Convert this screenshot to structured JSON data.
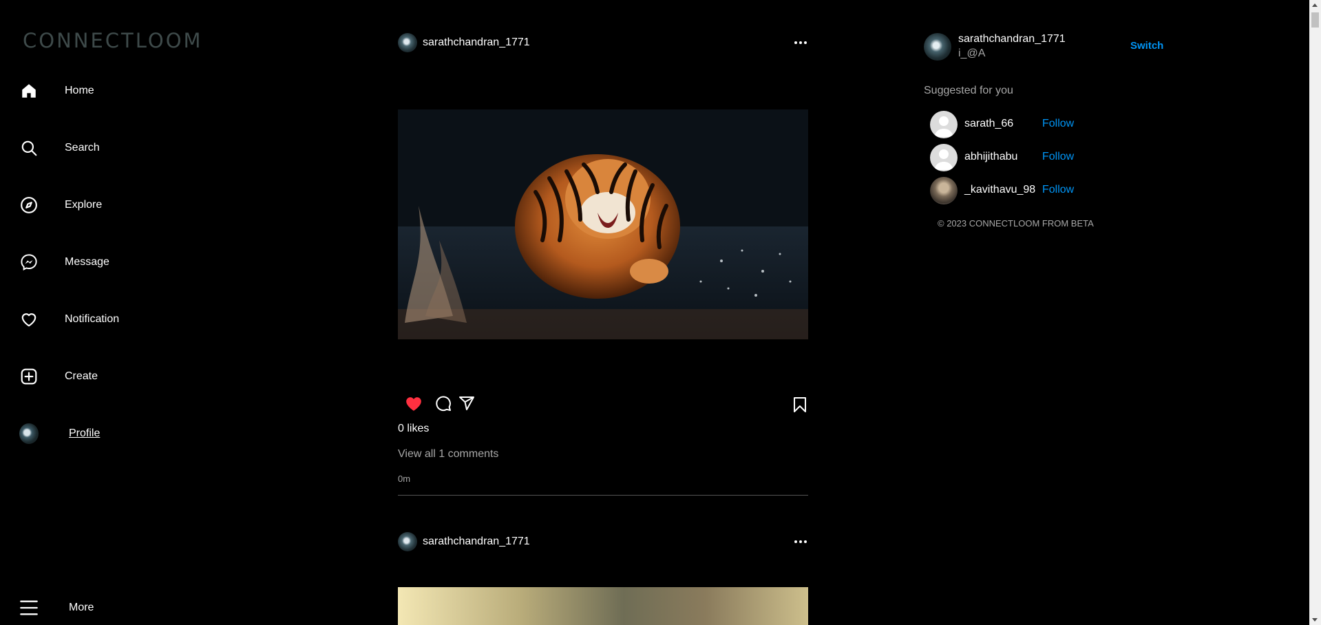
{
  "app": {
    "logo": "CONNECTLOOM"
  },
  "sidebar": {
    "items": [
      {
        "label": "Home",
        "icon": "home-icon"
      },
      {
        "label": "Search",
        "icon": "search-icon"
      },
      {
        "label": "Explore",
        "icon": "compass-icon"
      },
      {
        "label": "Message",
        "icon": "messenger-icon"
      },
      {
        "label": "Notification",
        "icon": "heart-icon"
      },
      {
        "label": "Create",
        "icon": "plus-square-icon"
      },
      {
        "label": "Profile",
        "icon": "avatar"
      }
    ],
    "more_label": "More"
  },
  "feed": {
    "posts": [
      {
        "username": "sarathchandran_1771",
        "likes": "0 likes",
        "comments_link": "View all 1 comments",
        "time": "0m",
        "liked": true
      },
      {
        "username": "sarathchandran_1771"
      }
    ]
  },
  "right": {
    "me": {
      "username": "sarathchandran_1771",
      "subtitle": "i_@A",
      "switch_label": "Switch"
    },
    "suggested_title": "Suggested for you",
    "suggestions": [
      {
        "username": "sarath_66",
        "action": "Follow"
      },
      {
        "username": "abhijithabu",
        "action": "Follow"
      },
      {
        "username": "_kavithavu_98",
        "action": "Follow"
      }
    ],
    "copyright": "© 2023 CONNECTLOOM FROM BETA"
  },
  "colors": {
    "accent": "#0095f6",
    "like": "#ff3040",
    "background": "#000000"
  }
}
